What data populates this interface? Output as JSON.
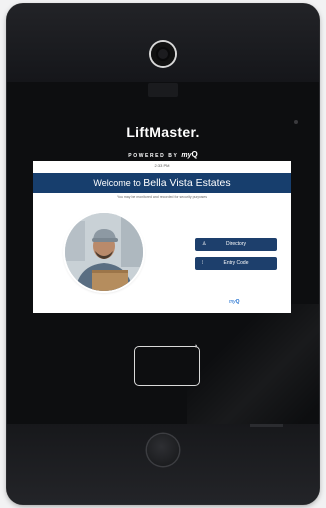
{
  "brand": {
    "name": "LiftMaster.",
    "powered_prefix": "POWERED BY",
    "myq_my": "my",
    "myq_q": "Q"
  },
  "screen": {
    "time": "2:33 PM",
    "welcome_prefix": "Welcome to",
    "site_name": "Bella Vista Estates",
    "subtitle": "You may be monitored and recorded for security purposes",
    "buttons": [
      {
        "label": "Directory",
        "icon": "person-icon"
      },
      {
        "label": "Entry Code",
        "icon": "keypad-icon"
      }
    ],
    "logo_my": "my",
    "logo_q": "Q"
  },
  "colors": {
    "banner": "#173e6d",
    "button": "#1d3f6c",
    "device": "#0d0e10",
    "myq_blue": "#1d6ed0"
  }
}
